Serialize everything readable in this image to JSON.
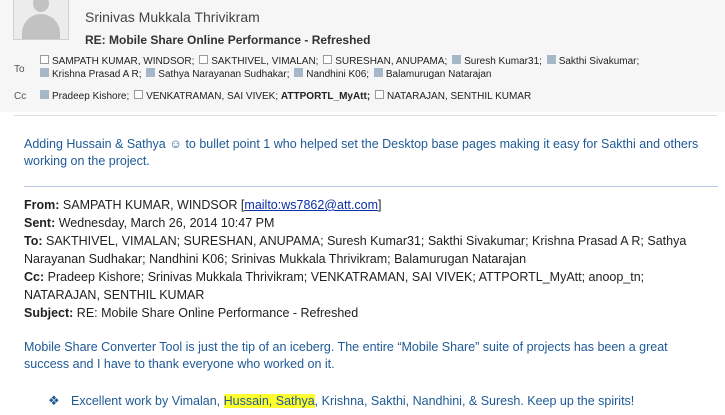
{
  "header": {
    "sender": "Srinivas Mukkala Thrivikram",
    "subject": "RE: Mobile Share Online Performance - Refreshed",
    "to_label": "To",
    "cc_label": "Cc",
    "to": [
      {
        "name": "SAMPATH KUMAR, WINDSOR;",
        "style": "empty"
      },
      {
        "name": "SAKTHIVEL, VIMALAN;",
        "style": "empty"
      },
      {
        "name": "SURESHAN, ANUPAMA;",
        "style": "empty"
      },
      {
        "name": "Suresh Kumar31;",
        "style": "filled"
      },
      {
        "name": "Sakthi Sivakumar;",
        "style": "filled"
      },
      {
        "name": "Krishna Prasad A R;",
        "style": "filled"
      },
      {
        "name": "Sathya Narayanan Sudhakar;",
        "style": "filled"
      },
      {
        "name": "Nandhini K06;",
        "style": "filled"
      },
      {
        "name": "Balamurugan Natarajan",
        "style": "filled"
      }
    ],
    "cc": [
      {
        "name": "Pradeep Kishore;",
        "style": "filled"
      },
      {
        "name": "VENKATRAMAN, SAI VIVEK;",
        "style": "empty"
      },
      {
        "name": "ATTPORTL_MyAtt;",
        "style": "bold"
      },
      {
        "name": "NATARAJAN, SENTHIL KUMAR",
        "style": "empty"
      }
    ]
  },
  "body": {
    "intro": "Adding Hussain & Sathya ☺ to bullet point 1 who helped set the Desktop base pages making it easy for Sakthi and others working on the project.",
    "forwarded": {
      "from_label": "From:",
      "from_value": "SAMPATH KUMAR, WINDSOR [",
      "from_link": "mailto:ws7862@att.com",
      "from_close": "]",
      "sent_label": "Sent:",
      "sent_value": "Wednesday, March 26, 2014 10:47 PM",
      "to_label": "To:",
      "to_value": "SAKTHIVEL, VIMALAN; SURESHAN, ANUPAMA; Suresh Kumar31; Sakthi Sivakumar; Krishna Prasad A R; Sathya Narayanan Sudhakar; Nandhini K06; Srinivas Mukkala Thrivikram; Balamurugan Natarajan",
      "cc_label": "Cc:",
      "cc_value": "Pradeep Kishore; Srinivas Mukkala Thrivikram; VENKATRAMAN, SAI VIVEK; ATTPORTL_MyAtt; anoop_tn; NATARAJAN, SENTHIL KUMAR",
      "subject_label": "Subject:",
      "subject_value": "RE: Mobile Share Online Performance - Refreshed"
    },
    "message": "Mobile Share Converter Tool is just the tip of an iceberg. The entire “Mobile Share” suite of projects has been a great success and I have to thank everyone who worked on it.",
    "bullet_glyph": "❖",
    "bullet1_before": "Excellent work by Vimalan, ",
    "bullet1_highlight": "Hussain, Sathya",
    "bullet1_after": ", Krishna, Sakthi, Nandhini,  & Suresh. Keep up the spirits!"
  }
}
